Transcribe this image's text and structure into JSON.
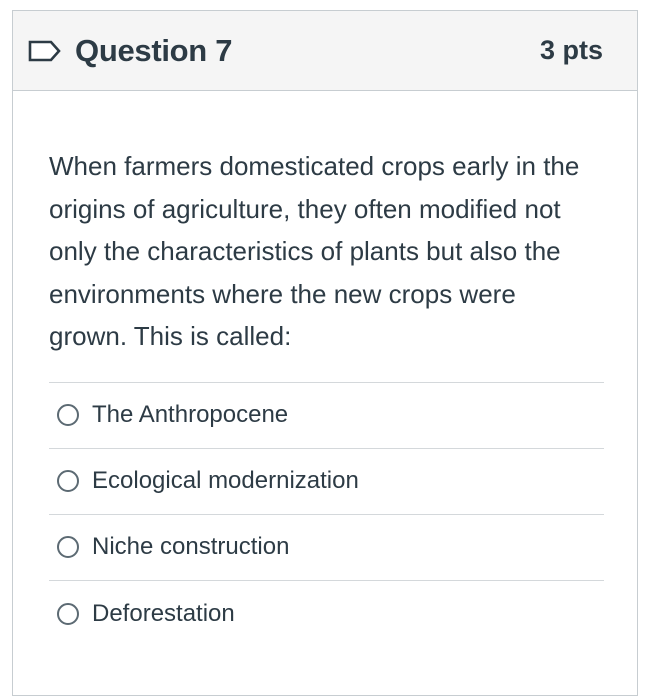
{
  "question": {
    "title": "Question 7",
    "points": "3 pts",
    "flag_icon": "flag-outline-icon",
    "text": "When farmers domesticated crops early in the origins of agriculture, they often modified not only the characteristics of plants but also the environments where the new crops were grown. This is called:",
    "answers": [
      {
        "label": "The Anthropocene",
        "selected": false
      },
      {
        "label": "Ecological modernization",
        "selected": false
      },
      {
        "label": "Niche construction",
        "selected": false
      },
      {
        "label": "Deforestation",
        "selected": false
      }
    ]
  },
  "colors": {
    "text": "#2d3b45",
    "header_bg": "#f5f5f5",
    "border": "#c7cdd1"
  }
}
